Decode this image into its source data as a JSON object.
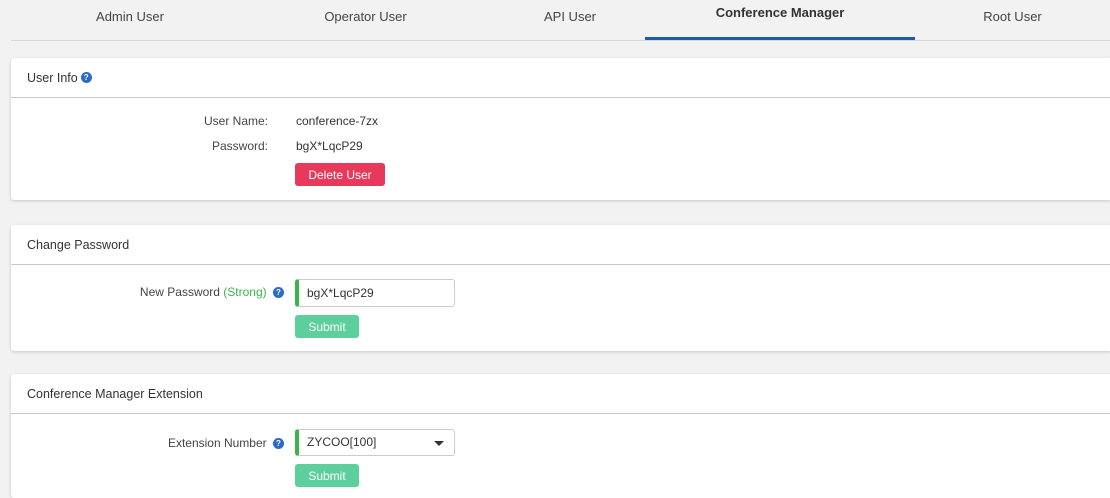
{
  "tabs": [
    {
      "label": "Admin User"
    },
    {
      "label": "Operator User"
    },
    {
      "label": "API User"
    },
    {
      "label": "Conference Manager"
    },
    {
      "label": "Root User"
    }
  ],
  "active_tab": "Conference Manager",
  "user_info": {
    "title": "User Info",
    "username_label": "User Name:",
    "username_value": "conference-7zx",
    "password_label": "Password:",
    "password_value": "bgX*LqcP29",
    "delete_button": "Delete User"
  },
  "change_password": {
    "title": "Change Password",
    "new_password_label": "New Password",
    "strength_label": "(Strong)",
    "new_password_value": "bgX*LqcP29",
    "submit_button": "Submit"
  },
  "extension": {
    "title": "Conference Manager Extension",
    "extension_label": "Extension Number",
    "extension_value": "ZYCOO[100]",
    "submit_button": "Submit"
  },
  "colors": {
    "active_tab_underline": "#1e5aa8",
    "danger": "#e8395a",
    "success": "#5ccf9c",
    "strong": "#3bb54a",
    "help_icon": "#2a6bc4"
  },
  "icons": {
    "help": "question-circle-icon",
    "dropdown": "caret-down-icon"
  }
}
